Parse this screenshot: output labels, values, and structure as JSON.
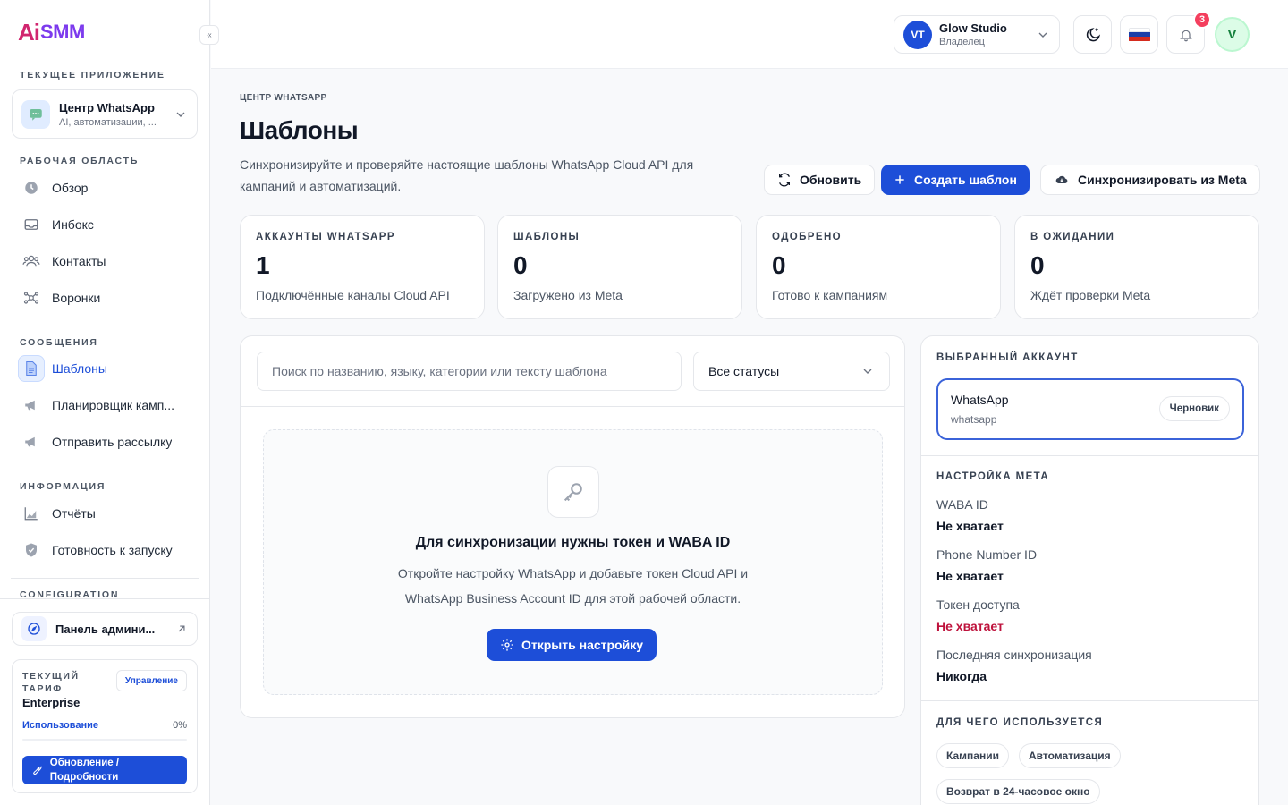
{
  "brand": {
    "logo_ai": "Ai",
    "logo_smm": "SMM",
    "primary": "#1d4ed8",
    "danger": "#be123c"
  },
  "sidebar": {
    "current_app_label": "ТЕКУЩЕЕ ПРИЛОЖЕНИЕ",
    "app_title": "Центр WhatsApp",
    "app_subtitle": "AI, автоматизации, ...",
    "workspace_label": "РАБОЧАЯ ОБЛАСТЬ",
    "workspace_items": [
      {
        "label": "Обзор",
        "icon": "clock-icon"
      },
      {
        "label": "Инбокс",
        "icon": "inbox-icon"
      },
      {
        "label": "Контакты",
        "icon": "users-icon"
      },
      {
        "label": "Воронки",
        "icon": "funnel-nodes-icon"
      }
    ],
    "messages_label": "СООБЩЕНИЯ",
    "messages_items": [
      {
        "label": "Шаблоны",
        "icon": "document-icon",
        "active": true
      },
      {
        "label": "Планировщик камп...",
        "icon": "megaphone-icon"
      },
      {
        "label": "Отправить рассылку",
        "icon": "megaphone-icon"
      }
    ],
    "info_label": "ИНФОРМАЦИЯ",
    "info_items": [
      {
        "label": "Отчёты",
        "icon": "chart-icon"
      },
      {
        "label": "Готовность к запуску",
        "icon": "shield-icon"
      }
    ],
    "config_label": "CONFIGURATION",
    "admin_panel": "Панель админи...",
    "plan": {
      "label": "ТЕКУЩИЙ ТАРИФ",
      "name": "Enterprise",
      "manage": "Управление",
      "usage_label": "Использование",
      "usage_value": "0%",
      "usage_fraction": 0,
      "upgrade": "Обновление / Подробности"
    }
  },
  "topbar": {
    "workspace_initials": "VT",
    "workspace_name": "Glow Studio",
    "workspace_role": "Владелец",
    "notifications_count": "3",
    "user_initial": "V"
  },
  "main": {
    "breadcrumb": "ЦЕНТР WHATSAPP",
    "title": "Шаблоны",
    "description": "Синхронизируйте и проверяйте настоящие шаблоны WhatsApp Cloud API для кампаний и автоматизаций.",
    "refresh": "Обновить",
    "create": "Создать шаблон",
    "sync": "Синхронизировать из Meta",
    "stats": [
      {
        "label": "АККАУНТЫ WHATSAPP",
        "value": "1",
        "desc": "Подключённые каналы Cloud API"
      },
      {
        "label": "ШАБЛОНЫ",
        "value": "0",
        "desc": "Загружено из Meta"
      },
      {
        "label": "ОДОБРЕНО",
        "value": "0",
        "desc": "Готово к кампаниям"
      },
      {
        "label": "В ОЖИДАНИИ",
        "value": "0",
        "desc": "Ждёт проверки Meta"
      }
    ],
    "search_placeholder": "Поиск по названию, языку, категории или тексту шаблона",
    "status_filter": "Все статусы",
    "empty": {
      "title": "Для синхронизации нужны токен и WABA ID",
      "desc": "Откройте настройку WhatsApp и добавьте токен Cloud API и WhatsApp Business Account ID для этой рабочей области.",
      "button": "Открыть настройку"
    }
  },
  "side": {
    "selected_label": "ВЫБРАННЫЙ АККАУНТ",
    "account_name": "WhatsApp",
    "account_type": "whatsapp",
    "account_status": "Черновик",
    "meta_label": "НАСТРОЙКА МЕТА",
    "meta": [
      {
        "key": "WABA ID",
        "value": "Не хватает"
      },
      {
        "key": "Phone Number ID",
        "value": "Не хватает"
      },
      {
        "key": "Токен доступа",
        "value": "Не хватает"
      },
      {
        "key": "Последняя синхронизация",
        "value": "Никогда"
      }
    ],
    "usage_label": "ДЛЯ ЧЕГО ИСПОЛЬЗУЕТСЯ",
    "usage_tags": [
      "Кампании",
      "Автоматизация",
      "Возврат в 24-часовое окно"
    ]
  }
}
